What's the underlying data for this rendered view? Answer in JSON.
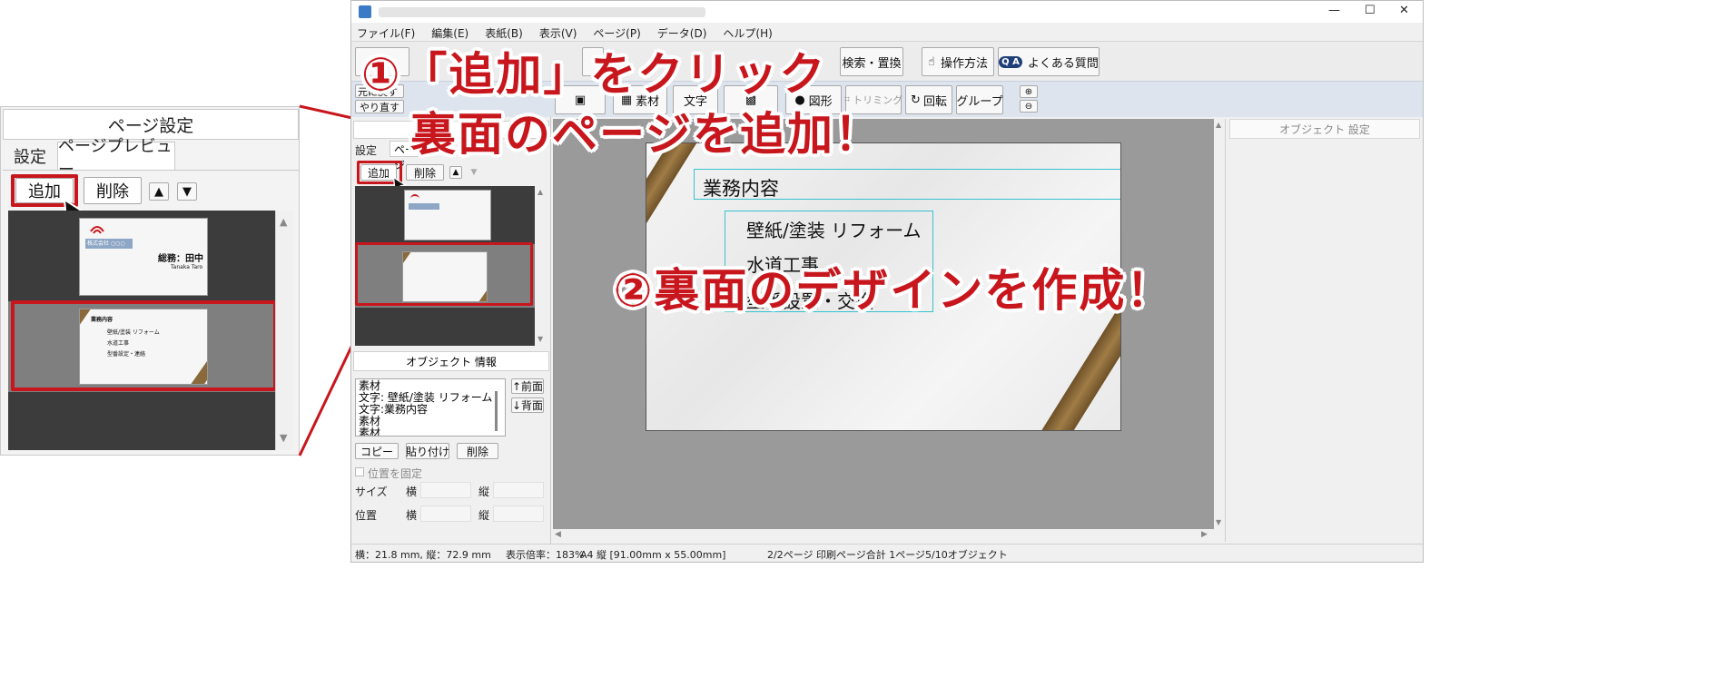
{
  "zoom_panel": {
    "title": "ページ設定",
    "tabs": [
      "設定",
      "ページプレビュー"
    ],
    "add_label": "追加",
    "delete_label": "削除",
    "up_arrow": "▲",
    "down_arrow": "▼",
    "card_front": {
      "company": "株式会社 ○○○",
      "name": "総務：田中",
      "romaji": "Tanaka Taro"
    },
    "card_back_lines": [
      "業務内容",
      "壁紙/塗装 リフォーム",
      "水道工事",
      "型番設定・連絡"
    ]
  },
  "window": {
    "title_blurred": "",
    "controls": {
      "minimize": "—",
      "maximize": "☐",
      "close": "✕"
    },
    "menu": [
      "ファイル(F)",
      "編集(E)",
      "表紙(B)",
      "表示(V)",
      "ページ(P)",
      "データ(D)",
      "ヘルプ(H)"
    ],
    "toolbar_top": {
      "search_replace": "検索・置換",
      "how_to": "操作方法",
      "faq": "よくある質問"
    },
    "toolbar_second": {
      "undo": "元に戻す",
      "redo": "やり直す",
      "material": "素材",
      "text": "文字",
      "shape": "図形",
      "trim": "トリミング",
      "rotate": "回転",
      "group": "グループ"
    },
    "left_panel": {
      "tabs": [
        "設定",
        "ページ"
      ],
      "add_label": "追加",
      "delete_label": "削除",
      "object_info_title": "オブジェクト 情報",
      "object_list": [
        "素材",
        "文字:  壁紙/塗装  リフォーム",
        "文字:業務内容",
        "素材",
        "素材"
      ],
      "front_label": "↑前面",
      "back_label": "↓背面",
      "copy_label": "コピー",
      "paste_label": "貼り付け",
      "obj_delete_label": "削除",
      "lock_label": "位置を固定",
      "size_label": "サイズ",
      "position_label": "位置",
      "width_label": "横",
      "height_label": "縦"
    },
    "right_panel": {
      "title": "オブジェクト 設定"
    },
    "canvas": {
      "card_heading": "業務内容",
      "card_line1": "壁紙/塗装  リフォーム",
      "card_line2_partial": "水道工事",
      "card_line3_partial": "型番設置・交換"
    },
    "status_bar": {
      "coords": "横：21.8 mm, 縦：72.9 mm",
      "zoom": "表示倍率：183%",
      "paper": "A4 縦 [91.00mm x 55.00mm]",
      "pages": "2/2ページ 印刷ページ合計 1ページ",
      "objects": "5/10オブジェクト"
    }
  },
  "annotations": {
    "step1_line1": "①「追加」をクリック",
    "step1_line2": "裏面のページを追加！",
    "step2": "②裏面のデザインを作成！"
  },
  "colors": {
    "accent_red": "#c8161d",
    "panel_dark": "#3c3c3c",
    "canvas_gray": "#9a9a9a",
    "brown_stripe": "#8a6a3a"
  }
}
